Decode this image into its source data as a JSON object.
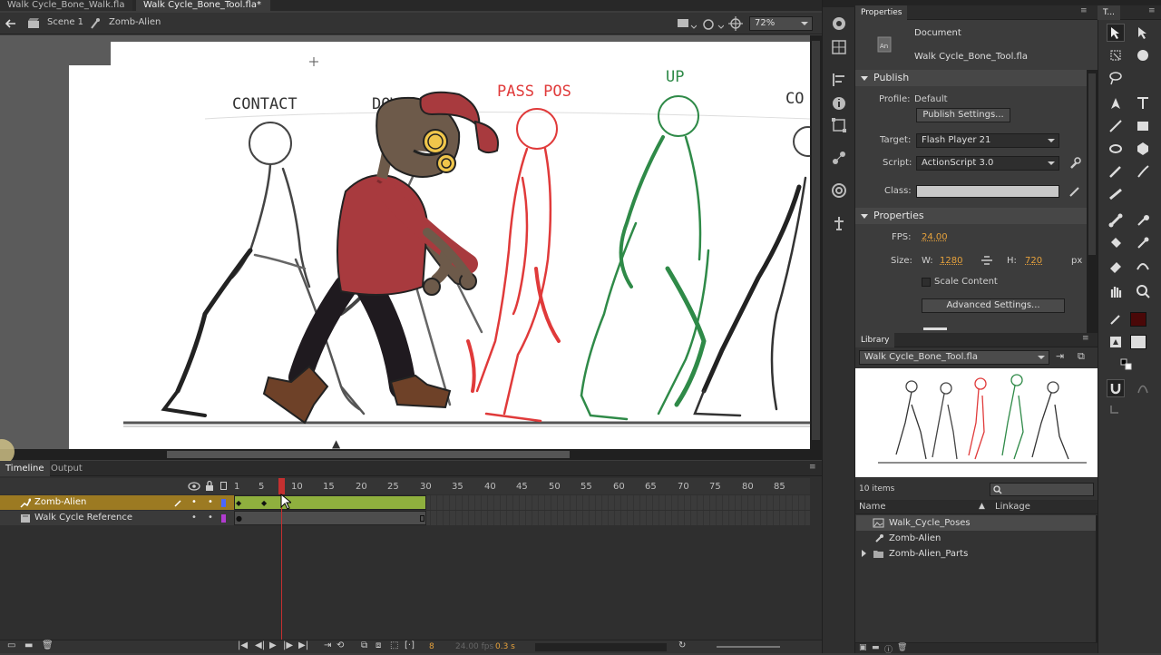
{
  "tabs": [
    "Walk Cycle_Bone_Walk.fla",
    "Walk Cycle_Bone_Tool.fla*"
  ],
  "edit_bar": {
    "scene": "Scene 1",
    "symbol": "Zomb-Alien",
    "zoom": "72%"
  },
  "stage": {
    "pose_labels": [
      "CONTACT",
      "DOWN",
      "PASS POS",
      "UP",
      "CO"
    ],
    "colors": {
      "pose_black": "#262626",
      "pose_red": "#e03a3a",
      "pose_green": "#2f8a48"
    }
  },
  "properties": {
    "title": "Properties",
    "doc_type": "Document",
    "doc_name": "Walk Cycle_Bone_Tool.fla",
    "publish_header": "Publish",
    "profile_label": "Profile:",
    "profile_value": "Default",
    "publish_settings_btn": "Publish Settings...",
    "target_label": "Target:",
    "target_value": "Flash Player 21",
    "script_label": "Script:",
    "script_value": "ActionScript 3.0",
    "class_label": "Class:",
    "props_header": "Properties",
    "fps_label": "FPS:",
    "fps_value": "24.00",
    "size_label": "Size:",
    "w_label": "W:",
    "w_value": "1280",
    "h_label": "H:",
    "h_value": "720",
    "unit": "px",
    "scale_content": "Scale Content",
    "advanced_btn": "Advanced Settings..."
  },
  "tools_panel": {
    "title": "T..."
  },
  "library": {
    "title": "Library",
    "file": "Walk Cycle_Bone_Tool.fla",
    "count": "10 items",
    "col_name": "Name",
    "col_linkage": "Linkage",
    "items": [
      "Walk_Cycle_Poses",
      "Zomb-Alien",
      "Zomb-Alien_Parts"
    ]
  },
  "timeline": {
    "tabs": [
      "Timeline",
      "Output"
    ],
    "frame_numbers": [
      "1",
      "5",
      "10",
      "15",
      "20",
      "25",
      "30",
      "35",
      "40",
      "45",
      "50",
      "55",
      "60",
      "65",
      "70",
      "75",
      "80",
      "85"
    ],
    "layers": [
      "Zomb-Alien",
      "Walk Cycle Reference"
    ],
    "current_frame": "8",
    "fps": "24.00 fps",
    "time": "0.3 s"
  }
}
